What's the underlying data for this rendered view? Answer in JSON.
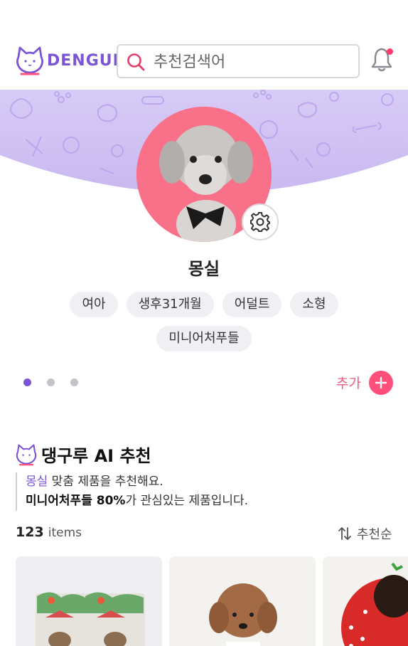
{
  "header": {
    "logo_text": "DENGURU",
    "search_placeholder": "추천검색어"
  },
  "profile": {
    "name": "몽실",
    "tags": [
      "여아",
      "생후31개월",
      "어덜트",
      "소형",
      "미니어처푸들"
    ]
  },
  "carousel": {
    "page_count": 3,
    "active_index": 0
  },
  "add_label": "추가",
  "recommend": {
    "title": "댕구루 AI 추천",
    "line1_name": "몽실",
    "line1_rest": " 맞춤 제품을 추천해요.",
    "line2_breed": "미니어처푸들",
    "line2_percent": " 80%",
    "line2_rest": "가 관심있는 제품입니다.",
    "count": "123",
    "count_unit": "items",
    "sort_label": "추천순"
  },
  "colors": {
    "brand_purple": "#7b55d6",
    "accent_pink": "#ff4f7a",
    "banner_lavender": "#cfc0f2",
    "avatar_bg": "#f97089"
  },
  "icons": {
    "search": "search-icon",
    "bell": "bell-icon",
    "settings": "gear-icon",
    "add": "plus-icon",
    "sort": "sort-arrows-icon"
  }
}
